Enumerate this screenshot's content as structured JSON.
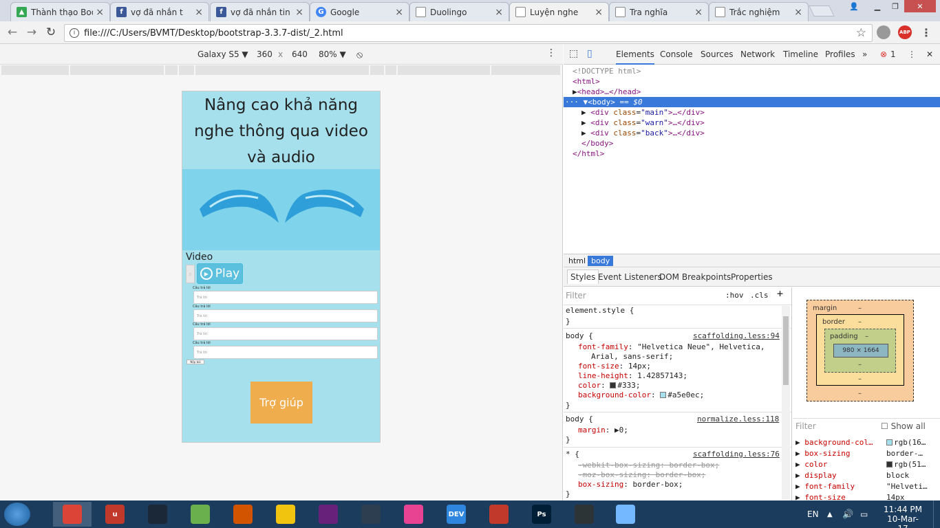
{
  "browser": {
    "tabs": [
      {
        "title": "Thành thạo Boo",
        "icon": "drive-icon",
        "color": "#34a853"
      },
      {
        "title": "vợ đã nhắn t",
        "icon": "facebook-icon",
        "color": "#3b5998"
      },
      {
        "title": "vợ đã nhắn tin c",
        "icon": "facebook-icon",
        "color": "#3b5998"
      },
      {
        "title": "Google",
        "icon": "google-icon",
        "color": "#4285f4"
      },
      {
        "title": "Duolingo",
        "icon": "page-icon",
        "color": "#888888"
      },
      {
        "title": "Luyện nghe",
        "icon": "page-icon",
        "color": "#888888"
      },
      {
        "title": "Tra nghĩa",
        "icon": "page-icon",
        "color": "#888888"
      },
      {
        "title": "Trắc nghiệm",
        "icon": "page-icon",
        "color": "#888888"
      }
    ],
    "url": "file:///C:/Users/BVMT/Desktop/bootstrap-3.3.7-dist/_2.html",
    "abp_label": "ABP"
  },
  "device_toolbar": {
    "device": "Galaxy S5",
    "width": "360",
    "times": "x",
    "height": "640",
    "zoom": "80%"
  },
  "page": {
    "title": "Nâng cao khả năng nghe thông qua video và audio",
    "video_label": "Video",
    "play_label": "Play",
    "questions": [
      {
        "label": "Câu trả lời",
        "placeholder": "Trả lời"
      },
      {
        "label": "Câu trả lời",
        "placeholder": "Trả lời"
      },
      {
        "label": "Câu trả lời",
        "placeholder": "Trả lời"
      },
      {
        "label": "Câu trả lời",
        "placeholder": "Trả lời"
      }
    ],
    "submit_label": "Nộp bài",
    "help_label": "Trợ giúp"
  },
  "devtools": {
    "tabs": [
      "Elements",
      "Console",
      "Sources",
      "Network",
      "Timeline",
      "Profiles"
    ],
    "error_count": "1",
    "dom": {
      "doctype": "<!DOCTYPE html>",
      "html_open": "<html>",
      "head": "<head>…</head>",
      "body_open": "<body>",
      "body_eq": "== $0",
      "divs": [
        "main",
        "warn",
        "back"
      ],
      "body_close": "</body>",
      "html_close": "</html>"
    },
    "breadcrumbs": [
      "html",
      "body"
    ],
    "sub_tabs": [
      "Styles",
      "Event Listeners",
      "DOM Breakpoints",
      "Properties"
    ],
    "filter_placeholder": "Filter",
    "hov": ":hov",
    "cls": ".cls",
    "rules": {
      "element_style": "element.style {",
      "close_brace": "}",
      "body_selector": "body {",
      "scaffolding_src": "scaffolding.less:94",
      "font_family_prop": "font-family",
      "font_family_val": "\"Helvetica Neue\", Helvetica,",
      "font_family_val2": "Arial, sans-serif;",
      "font_size_prop": "font-size",
      "font_size_val": "14px;",
      "line_height_prop": "line-height",
      "line_height_val": "1.42857143;",
      "color_prop": "color",
      "color_val": "#333;",
      "bg_prop": "background-color",
      "bg_val": "#a5e0ec;",
      "normalize_src": "normalize.less:118",
      "margin_prop": "margin",
      "margin_val": "0;",
      "star_selector": "* {",
      "scaffolding_src2": "scaffolding.less:76",
      "webkit_bs": "-webkit-box-sizing: border-box;",
      "moz_bs": "-moz-box-sizing: border-box;",
      "bs_prop": "box-sizing",
      "bs_val": "border-box;"
    },
    "box_model": {
      "margin": "margin",
      "border": "border",
      "padding": "padding",
      "content": "980 × 1664",
      "dash": "–"
    },
    "computed_filter": "Filter",
    "show_all": "Show all",
    "computed": [
      {
        "prop": "background-col…",
        "val": "rgb(16…"
      },
      {
        "prop": "box-sizing",
        "val": "border-…"
      },
      {
        "prop": "color",
        "val": "rgb(51…"
      },
      {
        "prop": "display",
        "val": "block"
      },
      {
        "prop": "font-family",
        "val": "\"Helveti…"
      },
      {
        "prop": "font-size",
        "val": "14px"
      }
    ]
  },
  "taskbar": {
    "lang": "EN",
    "time": "11:44 PM",
    "date": "10-Mar-17",
    "apps": [
      {
        "name": "chrome-icon",
        "color": "#db4437",
        "label": ""
      },
      {
        "name": "unikey-icon",
        "color": "#c0392b",
        "label": "u"
      },
      {
        "name": "steam-icon",
        "color": "#1b2838",
        "label": ""
      },
      {
        "name": "utorrent-icon",
        "color": "#6ab04c",
        "label": ""
      },
      {
        "name": "game-icon",
        "color": "#d35400",
        "label": ""
      },
      {
        "name": "file-explorer-icon",
        "color": "#f1c40f",
        "label": ""
      },
      {
        "name": "visual-studio-icon",
        "color": "#68217a",
        "label": ""
      },
      {
        "name": "app-icon",
        "color": "#2c3e50",
        "label": ""
      },
      {
        "name": "itunes-icon",
        "color": "#e84393",
        "label": ""
      },
      {
        "name": "devcpp-icon",
        "color": "#2e86de",
        "label": "DEV"
      },
      {
        "name": "red-app-icon",
        "color": "#c0392b",
        "label": ""
      },
      {
        "name": "photoshop-icon",
        "color": "#001e36",
        "label": "Ps"
      },
      {
        "name": "spiral-icon",
        "color": "#2d3436",
        "label": ""
      },
      {
        "name": "paint-icon",
        "color": "#74b9ff",
        "label": ""
      }
    ]
  }
}
